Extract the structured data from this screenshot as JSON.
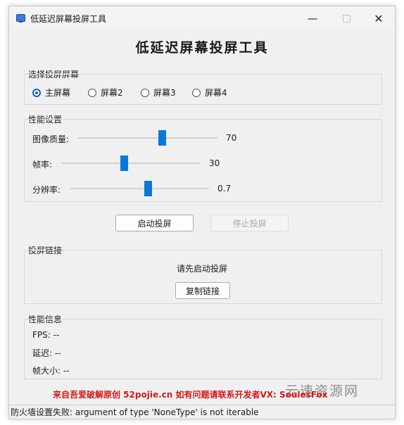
{
  "window": {
    "title": "低延迟屏幕投屏工具",
    "heading": "低延迟屏幕投屏工具",
    "icon": "monitor-icon"
  },
  "screen_select": {
    "label": "选择投屏屏幕",
    "options": [
      "主屏幕",
      "屏幕2",
      "屏幕3",
      "屏幕4"
    ],
    "selected": "主屏幕"
  },
  "performance": {
    "label": "性能设置",
    "quality": {
      "label": "图像质量:",
      "value": "70",
      "fraction": 0.6
    },
    "fps": {
      "label": "帧率:",
      "value": "30",
      "fraction": 0.45
    },
    "resolution": {
      "label": "分辨率:",
      "value": "0.7",
      "fraction": 0.56
    }
  },
  "actions": {
    "start": "启动投屏",
    "stop": "停止投屏"
  },
  "link": {
    "label": "投屏链接",
    "status": "请先启动投屏",
    "copy": "复制链接"
  },
  "info": {
    "label": "性能信息",
    "fps": "FPS: --",
    "latency": "延迟: --",
    "frame_size": "帧大小: --"
  },
  "credit": "来自吾爱破解原创 52pojie.cn 如有问题请联系开发者VX: SoulesFox",
  "watermark": "云速资源网",
  "status_bar": "防火墙设置失败: argument of type 'NoneType' is not iterable",
  "colors": {
    "accent": "#0a78d7",
    "credit": "#d21a1a"
  }
}
